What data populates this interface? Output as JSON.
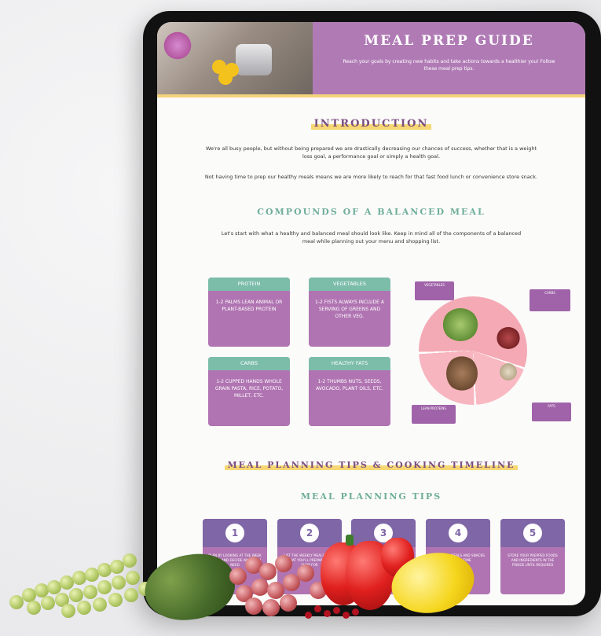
{
  "header": {
    "title": "MEAL PREP GUIDE",
    "subtitle": "Reach your goals by creating new habits and take actions towards a healthier you! Follow these meal prep tips."
  },
  "introduction": {
    "title": "INTRODUCTION",
    "paragraphs": [
      "We're all busy people, but without being prepared we are drastically decreasing our chances of success, whether that is a weight loss goal, a performance goal or simply a health goal.",
      "Not having time to prep our healthy meals means we are more likely to reach for that fast food lunch or convenience store snack."
    ]
  },
  "compounds": {
    "title": "COMPOUNDS OF A BALANCED MEAL",
    "paragraph": "Let's start with what a healthy and balanced meal should look like. Keep in mind all of the components of a balanced meal while planning out your menu and shopping list.",
    "cards": [
      {
        "title": "PROTEIN",
        "body": "1-2 PALMS LEAN ANIMAL OR PLANT-BASED PROTEIN"
      },
      {
        "title": "VEGETABLES",
        "body": "1-2 FISTS ALWAYS INCLUDE A SERVING OF GREENS AND OTHER VEG."
      },
      {
        "title": "CARBS",
        "body": "1-2 CUPPED HANDS WHOLE GRAIN PASTA, RICE, POTATO, MILLET, ETC."
      },
      {
        "title": "HEALTHY FATS",
        "body": "1-2 THUMBS NUTS, SEEDS, AVOCADO, PLANT OILS, ETC."
      }
    ],
    "plate_labels": {
      "veg": "VEGETABLES",
      "carbs": "CARBS",
      "protein": "LEAN PROTEINS",
      "fats": "FATS"
    }
  },
  "tips_section": {
    "title": "MEAL PLANNING TIPS & COOKING TIMELINE",
    "subtitle": "MEAL PLANNING TIPS",
    "tips": [
      {
        "num": "1",
        "text": "PLAN BY LOOKING AT THE WEEK AHEAD AND DECIDE WHAT YOU NEED"
      },
      {
        "num": "2",
        "text": "LIST THE WEEKLY MEALS, PLAN WHAT YOU'LL PREPARE AND SHOP FOR"
      },
      {
        "num": "3",
        "text": ""
      },
      {
        "num": "4",
        "text": "PREP YOUR MEALS AND SNACKS AHEAD OF TIME"
      },
      {
        "num": "5",
        "text": "STORE YOUR PREPPED FOODS AND INGREDIENTS IN THE FRIDGE UNTIL REQUIRED"
      }
    ]
  },
  "colors": {
    "purple": "#b07bb5",
    "teal": "#7cbdaa",
    "yellow": "#f6d773",
    "tip_header": "#7f66a6"
  }
}
